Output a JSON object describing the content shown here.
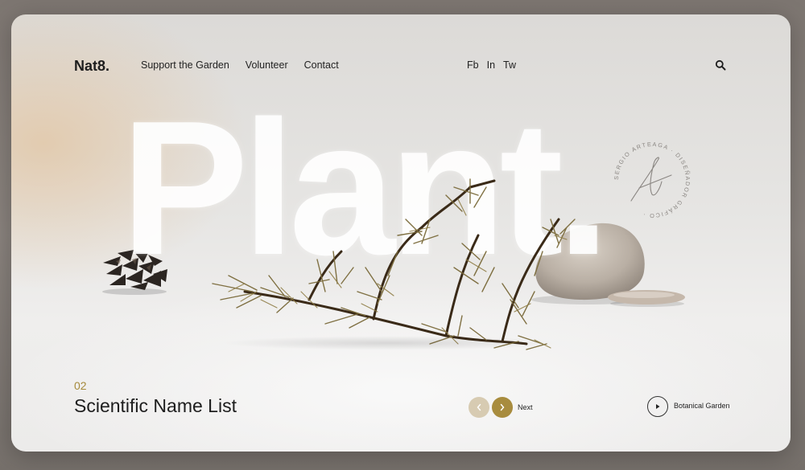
{
  "header": {
    "logo": "Nat8.",
    "nav": [
      "Support the Garden",
      "Volunteer",
      "Contact"
    ],
    "social": [
      "Fb",
      "In",
      "Tw"
    ],
    "search_icon": "search-icon"
  },
  "hero": {
    "word": "Plant.",
    "stamp_text": "SERGIO ARTEAGA · DISEÑADOR GRÁFICO"
  },
  "footer": {
    "number": "02",
    "title": "Scientific Name List",
    "prev_icon": "chevron-left-icon",
    "next_icon": "chevron-right-icon",
    "next_label": "Next",
    "play_icon": "play-icon",
    "garden_label": "Botanical Garden"
  },
  "colors": {
    "accent": "#a88c3e",
    "accent_light": "#d7cbb2",
    "text": "#1e1e1e"
  }
}
